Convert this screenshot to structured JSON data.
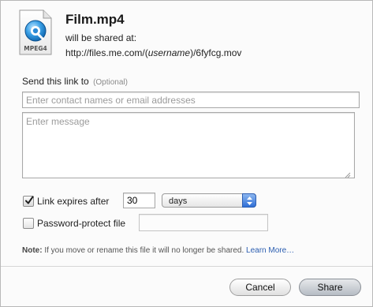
{
  "file": {
    "icon": "mpeg4-quicktime-file-icon",
    "icon_label": "MPEG4",
    "name": "Film.mp4",
    "shared_text": "will be shared at:",
    "url_prefix": "http://files.me.com/(",
    "url_username": "username",
    "url_suffix": ")/6fyfcg.mov"
  },
  "send": {
    "label": "Send this link to",
    "optional": "(Optional)",
    "contacts_placeholder": "Enter contact names or email addresses",
    "contacts_value": "",
    "message_placeholder": "Enter message",
    "message_value": ""
  },
  "expiry": {
    "checked": true,
    "label": "Link expires after",
    "amount": "30",
    "unit": "days"
  },
  "password": {
    "checked": false,
    "label": "Password-protect file",
    "value": ""
  },
  "note": {
    "prefix": "Note:",
    "text": " If you move or rename this file it will no longer be shared. ",
    "link": "Learn More…"
  },
  "buttons": {
    "cancel": "Cancel",
    "share": "Share"
  },
  "colors": {
    "link": "#2a5db0",
    "select_arrow": "#2f6fd6"
  }
}
